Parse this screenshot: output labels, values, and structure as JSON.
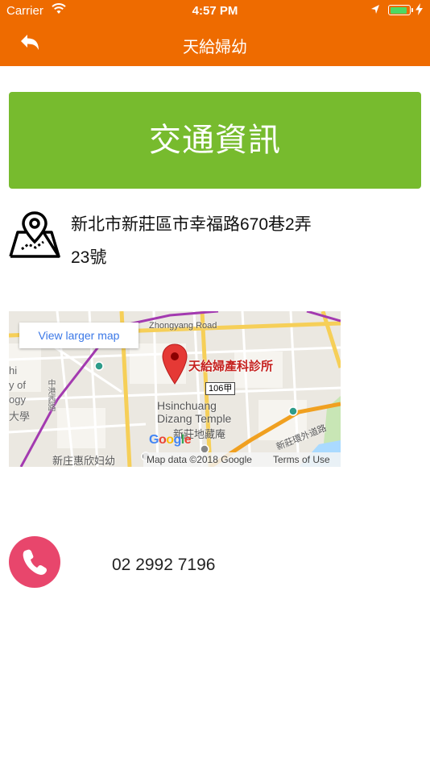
{
  "status_bar": {
    "carrier": "Carrier",
    "time": "4:57 PM"
  },
  "nav": {
    "title": "天給婦幼",
    "back_icon": "back-arrow-icon"
  },
  "banner": {
    "label": "交通資訊",
    "color": "#77bb2e"
  },
  "address": {
    "icon": "map-location-icon",
    "line1": "新北市新莊區市幸福路670巷2弄",
    "line2": "23號"
  },
  "map": {
    "view_larger": "View larger map",
    "place_name": "天給婦產科診所",
    "road_top": "Zhongyang Road",
    "shield": "106甲",
    "temple_en_1": "Hsinchuang",
    "temple_en_2": "Dizang Temple",
    "temple_zh": "新莊地藏庵",
    "left_labels": [
      "hi",
      "y of",
      "ogy",
      "大學"
    ],
    "left_road": "中港西路",
    "right_road": "新莊環外道路",
    "bottom_label": "新庄惠欣妇幼",
    "google": [
      "G",
      "o",
      "o",
      "g",
      "l",
      "e"
    ],
    "attribution": "Map data ©2018 Google",
    "terms": "Terms of Use"
  },
  "phone": {
    "icon": "phone-icon",
    "number": "02 2992 7196",
    "color": "#e8466c"
  },
  "colors": {
    "accent": "#ee6b00"
  }
}
